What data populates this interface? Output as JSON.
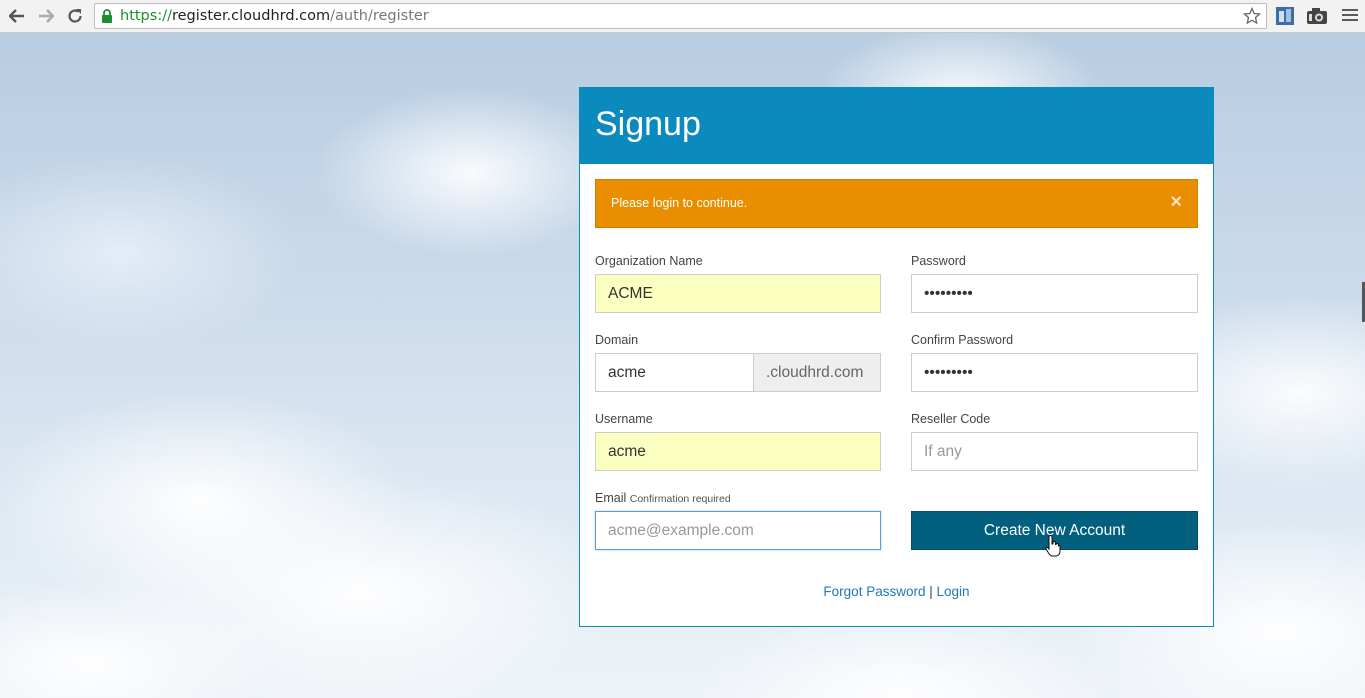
{
  "browser": {
    "url_scheme": "https://",
    "url_host": "register.cloudhrd.com",
    "url_path": "/auth/register"
  },
  "signup": {
    "title": "Signup",
    "alert": {
      "message": "Please login to continue.",
      "close_glyph": "×"
    },
    "fields": {
      "organization": {
        "label": "Organization Name",
        "value": "ACME"
      },
      "password": {
        "label": "Password",
        "value": "•••••••••"
      },
      "domain": {
        "label": "Domain",
        "value": "acme",
        "suffix": ".cloudhrd.com"
      },
      "confirm_password": {
        "label": "Confirm Password",
        "value": "•••••••••"
      },
      "username": {
        "label": "Username",
        "value": "acme"
      },
      "reseller_code": {
        "label": "Reseller Code",
        "placeholder": "If any"
      },
      "email": {
        "label": "Email",
        "hint": "Confirmation required",
        "placeholder": "acme@example.com"
      }
    },
    "create_button": "Create New Account",
    "links": {
      "forgot_password": "Forgot Password",
      "separator": "|",
      "login": "Login"
    }
  },
  "colors": {
    "header": "#0a8abd",
    "alert": "#e88e00",
    "button": "#02607f",
    "link": "#1f7ab7",
    "autofill": "#fbffbf"
  }
}
